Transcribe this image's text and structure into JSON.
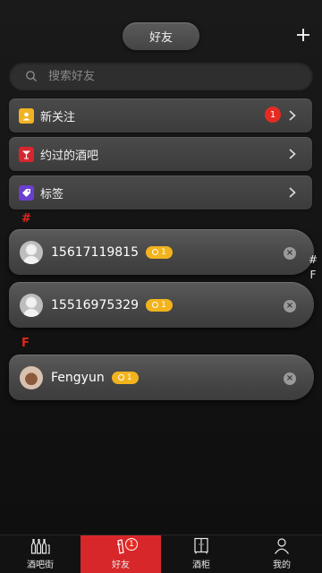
{
  "header": {
    "title": "好友",
    "add_icon": "plus-icon"
  },
  "search": {
    "placeholder": "搜索好友",
    "icon": "search-icon"
  },
  "menu": [
    {
      "label": "新关注",
      "icon": "new-follower-icon",
      "color": "#f0b324",
      "badge": "1"
    },
    {
      "label": "约过的酒吧",
      "icon": "cocktail-icon",
      "color": "#d7262f"
    },
    {
      "label": "标签",
      "icon": "tag-icon",
      "color": "#6a3fcf"
    }
  ],
  "sections": [
    {
      "letter": "#",
      "contacts": [
        {
          "name": "15617119815",
          "level": "1"
        },
        {
          "name": "15516975329",
          "level": "1"
        }
      ]
    },
    {
      "letter": "F",
      "contacts": [
        {
          "name": "Fengyun",
          "level": "1"
        }
      ]
    }
  ],
  "index": [
    "#",
    "F"
  ],
  "tabs": [
    {
      "label": "酒吧街",
      "icon": "bottles-icon",
      "active": false
    },
    {
      "label": "好友",
      "icon": "friends-icon",
      "active": true,
      "badge": "1"
    },
    {
      "label": "酒柜",
      "icon": "cabinet-icon",
      "active": false
    },
    {
      "label": "我的",
      "icon": "profile-icon",
      "active": false
    }
  ],
  "colors": {
    "accent_red": "#d7272a",
    "badge_red": "#e52b22",
    "level_gold": "#f2b31d"
  }
}
